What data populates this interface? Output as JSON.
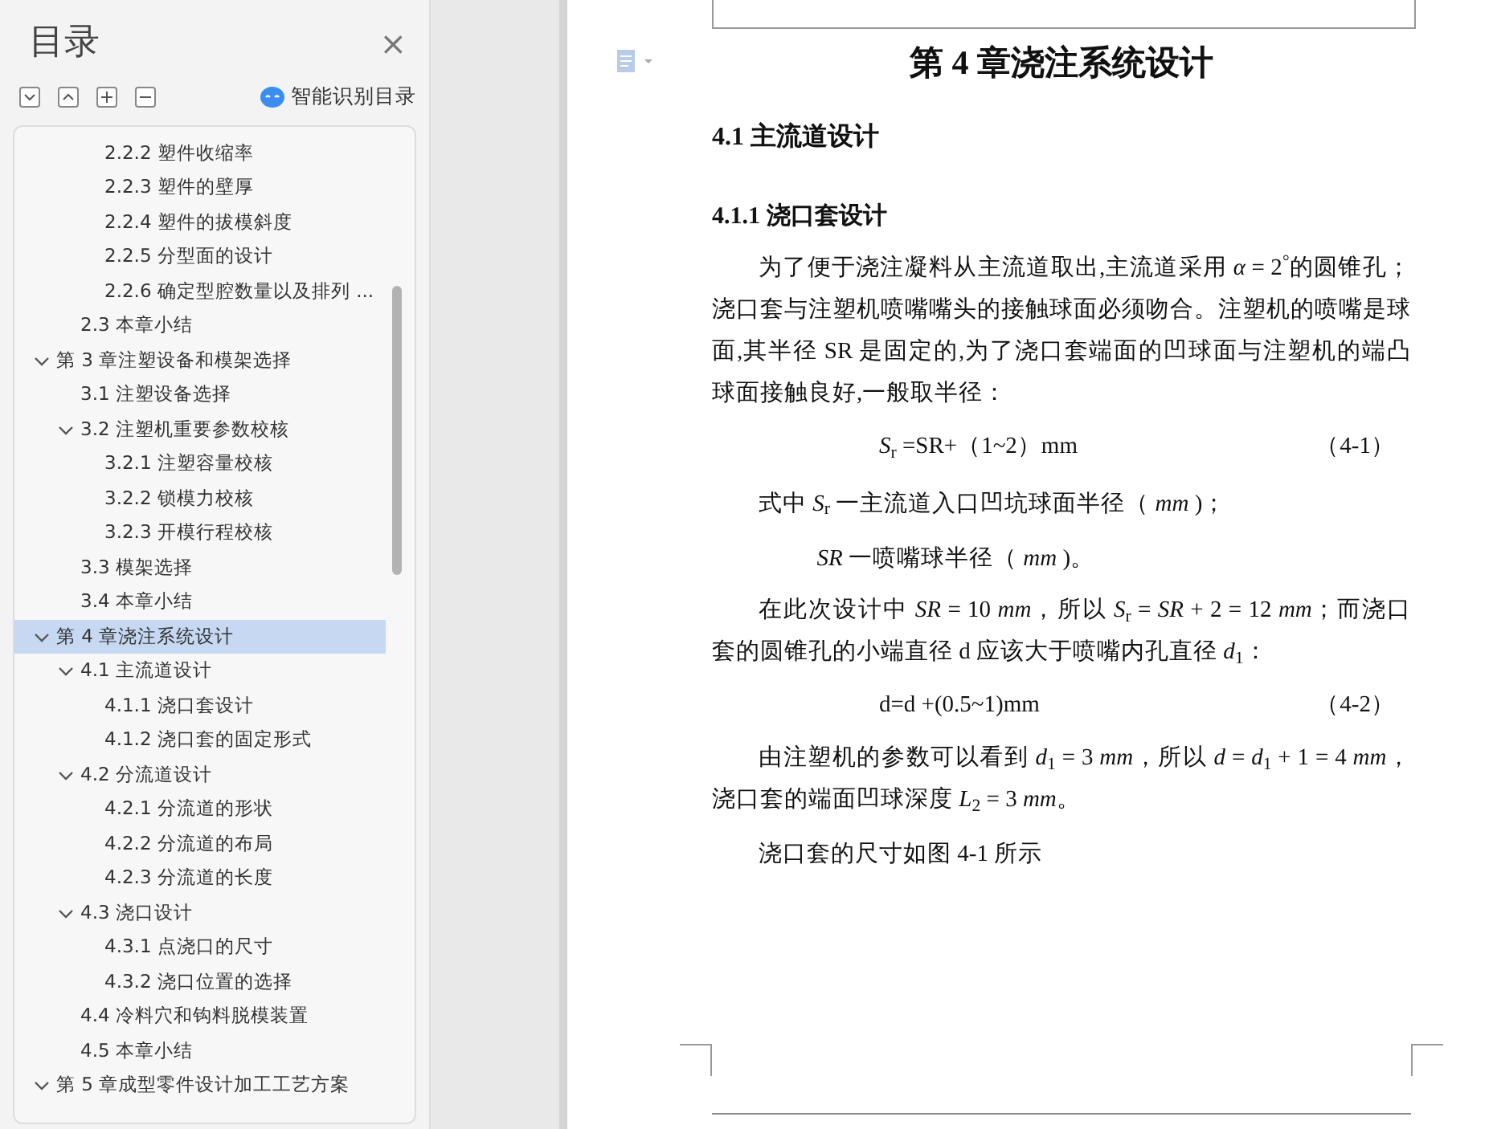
{
  "sidebar": {
    "title": "目录",
    "close": "×",
    "ai_button": "智能识别目录",
    "toc": [
      {
        "children": [
          {
            "children": [
              {
                "label": "2.2.2  塑件收缩率",
                "selected": false
              },
              {
                "label": "2.2.3  塑件的壁厚",
                "selected": false
              },
              {
                "label": "2.2.4  塑件的拔模斜度",
                "selected": false
              },
              {
                "label": "2.2.5  分型面的设计",
                "selected": false
              },
              {
                "label": "2.2.6  确定型腔数量以及排列 ...",
                "selected": false
              }
            ]
          },
          {
            "label": "2.3  本章小结",
            "selected": false
          }
        ]
      },
      {
        "label": "第 3 章注塑设备和模架选择",
        "selected": false,
        "expanded": true,
        "children": [
          {
            "label": "3.1  注塑设备选择",
            "selected": false
          },
          {
            "label": "3.2  注塑机重要参数校核",
            "selected": false,
            "expanded": true,
            "children": [
              {
                "label": "3.2.1  注塑容量校核",
                "selected": false
              },
              {
                "label": "3.2.2  锁模力校核",
                "selected": false
              },
              {
                "label": "3.2.3  开模行程校核",
                "selected": false
              }
            ]
          },
          {
            "label": "3.3  模架选择",
            "selected": false
          },
          {
            "label": "3.4  本章小结",
            "selected": false
          }
        ]
      },
      {
        "label": "第 4 章浇注系统设计",
        "selected": true,
        "expanded": true,
        "children": [
          {
            "label": "4.1  主流道设计",
            "selected": false,
            "expanded": true,
            "children": [
              {
                "label": "4.1.1  浇口套设计",
                "selected": false
              },
              {
                "label": "4.1.2  浇口套的固定形式",
                "selected": false
              }
            ]
          },
          {
            "label": "4.2  分流道设计",
            "selected": false,
            "expanded": true,
            "children": [
              {
                "label": "4.2.1  分流道的形状",
                "selected": false
              },
              {
                "label": "4.2.2  分流道的布局",
                "selected": false
              },
              {
                "label": "4.2.3  分流道的长度",
                "selected": false
              }
            ]
          },
          {
            "label": "4.3  浇口设计",
            "selected": false,
            "expanded": true,
            "children": [
              {
                "label": "4.3.1  点浇口的尺寸",
                "selected": false
              },
              {
                "label": "4.3.2  浇口位置的选择",
                "selected": false
              }
            ]
          },
          {
            "label": "4.4  冷料穴和钩料脱模装置",
            "selected": false
          },
          {
            "label": "4.5  本章小结",
            "selected": false
          }
        ]
      },
      {
        "label": "第 5 章成型零件设计加工工艺方案",
        "selected": false,
        "expanded": true
      }
    ]
  },
  "document": {
    "blocks": [
      {
        "kind": "h1",
        "text": "第 4 章浇注系统设计"
      },
      {
        "kind": "h2",
        "text": "4.1  主流道设计"
      },
      {
        "kind": "h3",
        "text": "4.1.1  浇口套设计"
      },
      {
        "kind": "para",
        "text": "为了便于浇注凝料从主流道取出,主流道采用 *α* = 2$^{°}$的圆锥孔；浇口套与注塑机喷嘴嘴头的接触球面必须吻合。注塑机的喷嘴是球面,其半径 SR 是固定的,为了浇口套端面的凹球面与注塑机的端凸球面接触良好,一般取半径："
      },
      {
        "kind": "equation",
        "text": "*S*$_{r}$ =SR+（1~2）mm",
        "number": "（4-1）"
      },
      {
        "kind": "indent",
        "text": "式中  *S*$_{r}$ 一主流道入口凹坑球面半径（ *mm* )；"
      },
      {
        "kind": "indent2",
        "text": "*SR* 一喷嘴球半径（ *mm* )。"
      },
      {
        "kind": "para",
        "text": "在此次设计中 *SR* = 10 *mm*，所以 *S*$_{r}$ = *SR* + 2 = 12 *mm*；而浇口套的圆锥孔的小端直径 d 应该大于喷嘴内孔直径 *d*$_{1}$："
      },
      {
        "kind": "equation",
        "text": "d=d +(0.5~1)mm",
        "number": "（4-2）"
      },
      {
        "kind": "para",
        "text": "由注塑机的参数可以看到 *d*$_{1}$ = 3 *mm*，所以 *d* = *d*$_{1}$ + 1 = 4 *mm*，浇口套的端面凹球深度 *L*$_{2}$ = 3 *mm*。"
      },
      {
        "kind": "para",
        "text": "浇口套的尺寸如图 4-1 所示"
      }
    ]
  }
}
